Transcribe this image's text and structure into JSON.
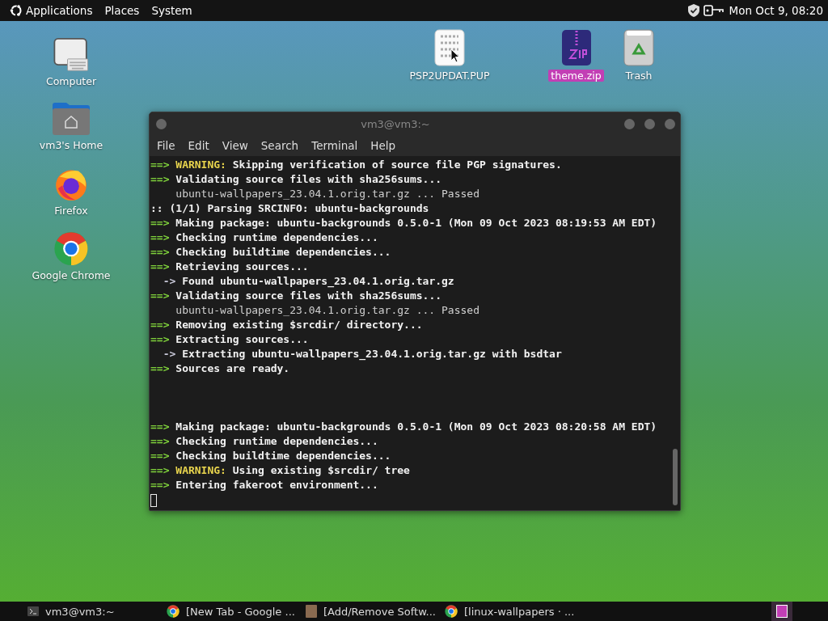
{
  "top_panel": {
    "menus": [
      "Applications",
      "Places",
      "System"
    ],
    "clock": "Mon Oct 9, 08:20"
  },
  "desktop_icons_left": [
    {
      "kind": "computer",
      "label": "Computer",
      "selected": false
    },
    {
      "kind": "home",
      "label": "vm3's Home",
      "selected": false
    },
    {
      "kind": "firefox",
      "label": "Firefox",
      "selected": false
    },
    {
      "kind": "chrome",
      "label": "Google Chrome",
      "selected": false
    }
  ],
  "desktop_icons_top": [
    {
      "kind": "file",
      "label": "PSP2UPDAT.PUP",
      "selected": false
    },
    {
      "kind": "zip",
      "label": "theme.zip",
      "selected": true
    },
    {
      "kind": "trash",
      "label": "Trash",
      "selected": false
    }
  ],
  "terminal": {
    "title": "vm3@vm3:~",
    "menu": [
      "File",
      "Edit",
      "View",
      "Search",
      "Terminal",
      "Help"
    ],
    "lines": [
      {
        "kind": "output",
        "segments": [
          {
            "kind": "prefix",
            "text": "==> "
          },
          {
            "kind": "warn",
            "text": "WARNING: "
          },
          {
            "kind": "bold",
            "text": "Skipping verification of source file PGP signatures."
          }
        ]
      },
      {
        "kind": "output",
        "segments": [
          {
            "kind": "prefix",
            "text": "==> "
          },
          {
            "kind": "bold",
            "text": "Validating source files with sha256sums..."
          }
        ]
      },
      {
        "kind": "output",
        "segments": [
          {
            "kind": "plain",
            "text": "    ubuntu-wallpapers_23.04.1.orig.tar.gz ... Passed"
          }
        ]
      },
      {
        "kind": "output",
        "segments": [
          {
            "kind": "bold",
            "text": ":: (1/1) Parsing SRCINFO: ubuntu-backgrounds"
          }
        ]
      },
      {
        "kind": "output",
        "segments": [
          {
            "kind": "prefix",
            "text": "==> "
          },
          {
            "kind": "bold",
            "text": "Making package: ubuntu-backgrounds 0.5.0-1 (Mon 09 Oct 2023 08:19:53 AM EDT)"
          }
        ]
      },
      {
        "kind": "output",
        "segments": [
          {
            "kind": "prefix",
            "text": "==> "
          },
          {
            "kind": "bold",
            "text": "Checking runtime dependencies..."
          }
        ]
      },
      {
        "kind": "output",
        "segments": [
          {
            "kind": "prefix",
            "text": "==> "
          },
          {
            "kind": "bold",
            "text": "Checking buildtime dependencies..."
          }
        ]
      },
      {
        "kind": "output",
        "segments": [
          {
            "kind": "prefix",
            "text": "==> "
          },
          {
            "kind": "bold",
            "text": "Retrieving sources..."
          }
        ]
      },
      {
        "kind": "output",
        "segments": [
          {
            "kind": "arrow",
            "text": "  -> "
          },
          {
            "kind": "bold",
            "text": "Found ubuntu-wallpapers_23.04.1.orig.tar.gz"
          }
        ]
      },
      {
        "kind": "output",
        "segments": [
          {
            "kind": "prefix",
            "text": "==> "
          },
          {
            "kind": "bold",
            "text": "Validating source files with sha256sums..."
          }
        ]
      },
      {
        "kind": "output",
        "segments": [
          {
            "kind": "plain",
            "text": "    ubuntu-wallpapers_23.04.1.orig.tar.gz ... Passed"
          }
        ]
      },
      {
        "kind": "output",
        "segments": [
          {
            "kind": "prefix",
            "text": "==> "
          },
          {
            "kind": "bold",
            "text": "Removing existing $srcdir/ directory..."
          }
        ]
      },
      {
        "kind": "output",
        "segments": [
          {
            "kind": "prefix",
            "text": "==> "
          },
          {
            "kind": "bold",
            "text": "Extracting sources..."
          }
        ]
      },
      {
        "kind": "output",
        "segments": [
          {
            "kind": "arrow",
            "text": "  -> "
          },
          {
            "kind": "bold",
            "text": "Extracting ubuntu-wallpapers_23.04.1.orig.tar.gz with bsdtar"
          }
        ]
      },
      {
        "kind": "output",
        "segments": [
          {
            "kind": "prefix",
            "text": "==> "
          },
          {
            "kind": "bold",
            "text": "Sources are ready."
          }
        ]
      },
      {
        "kind": "blank"
      },
      {
        "kind": "blank"
      },
      {
        "kind": "blank"
      },
      {
        "kind": "output",
        "segments": [
          {
            "kind": "prefix",
            "text": "==> "
          },
          {
            "kind": "bold",
            "text": "Making package: ubuntu-backgrounds 0.5.0-1 (Mon 09 Oct 2023 08:20:58 AM EDT)"
          }
        ]
      },
      {
        "kind": "output",
        "segments": [
          {
            "kind": "prefix",
            "text": "==> "
          },
          {
            "kind": "bold",
            "text": "Checking runtime dependencies..."
          }
        ]
      },
      {
        "kind": "output",
        "segments": [
          {
            "kind": "prefix",
            "text": "==> "
          },
          {
            "kind": "bold",
            "text": "Checking buildtime dependencies..."
          }
        ]
      },
      {
        "kind": "output",
        "segments": [
          {
            "kind": "prefix",
            "text": "==> "
          },
          {
            "kind": "warn",
            "text": "WARNING: "
          },
          {
            "kind": "bold",
            "text": "Using existing $srcdir/ tree"
          }
        ]
      },
      {
        "kind": "output",
        "segments": [
          {
            "kind": "prefix",
            "text": "==> "
          },
          {
            "kind": "bold",
            "text": "Entering fakeroot environment..."
          }
        ]
      },
      {
        "kind": "cursor"
      }
    ]
  },
  "taskbar": {
    "items": [
      {
        "kind": "terminal",
        "label": "vm3@vm3:~"
      },
      {
        "kind": "chrome",
        "label": "[New Tab - Google ..."
      },
      {
        "kind": "package",
        "label": "[Add/Remove Softw..."
      },
      {
        "kind": "chrome",
        "label": "[linux-wallpapers · ..."
      }
    ]
  }
}
